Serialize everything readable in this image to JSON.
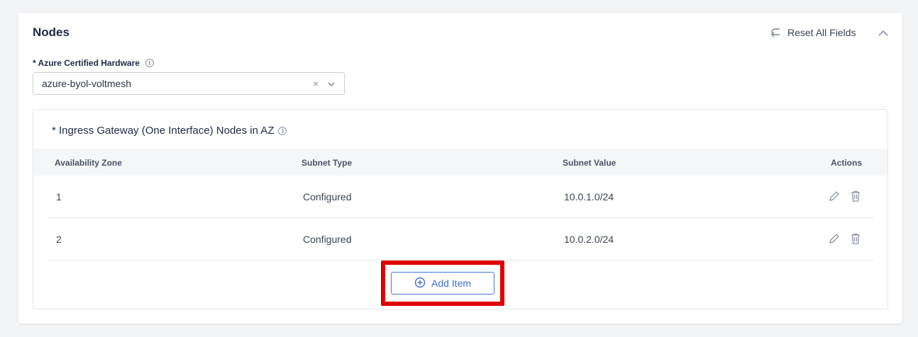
{
  "header": {
    "title": "Nodes",
    "reset_label": "Reset All Fields"
  },
  "hardware_field": {
    "label": "* Azure Certified Hardware",
    "value": "azure-byol-voltmesh",
    "clear_glyph": "×"
  },
  "ingress_section": {
    "title": "* Ingress Gateway (One Interface) Nodes in AZ",
    "columns": [
      "Availability Zone",
      "Subnet Type",
      "Subnet Value",
      "Actions"
    ],
    "rows": [
      {
        "zone": "1",
        "subnet_type": "Configured",
        "subnet_value": "10.0.1.0/24"
      },
      {
        "zone": "2",
        "subnet_type": "Configured",
        "subnet_value": "10.0.2.0/24"
      }
    ],
    "add_label": "Add Item"
  },
  "icons": {
    "reset": "undo-arrow-icon",
    "collapse": "chevron-up-icon",
    "info": "info-icon",
    "dropdown": "chevron-down-icon",
    "edit": "pencil-icon",
    "delete": "trash-icon",
    "add": "plus-circle-icon"
  },
  "colors": {
    "accent": "#3f6fd0",
    "highlight_box": "#e00000",
    "page_bg": "#f3f4f6"
  }
}
